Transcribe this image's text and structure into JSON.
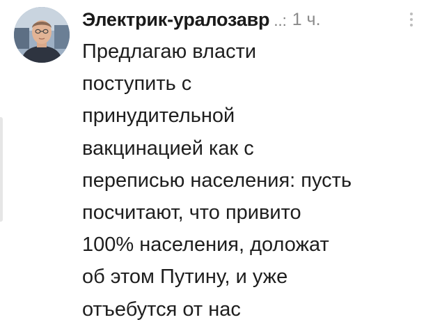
{
  "comment": {
    "author": "Электрик-уралозавр",
    "author_suffix": "..:",
    "time": "1 ч.",
    "lines": [
      "Предлагаю власти",
      "поступить с",
      "принудительной",
      "вакцинацией как с",
      "переписью населения: пусть",
      "посчитают, что привито",
      "100% населения, доложат",
      "об этом Путину, и уже",
      "отъебутся от нас"
    ]
  },
  "icons": {
    "avatar": "user-avatar-photo",
    "menu": "more-vertical-icon"
  }
}
